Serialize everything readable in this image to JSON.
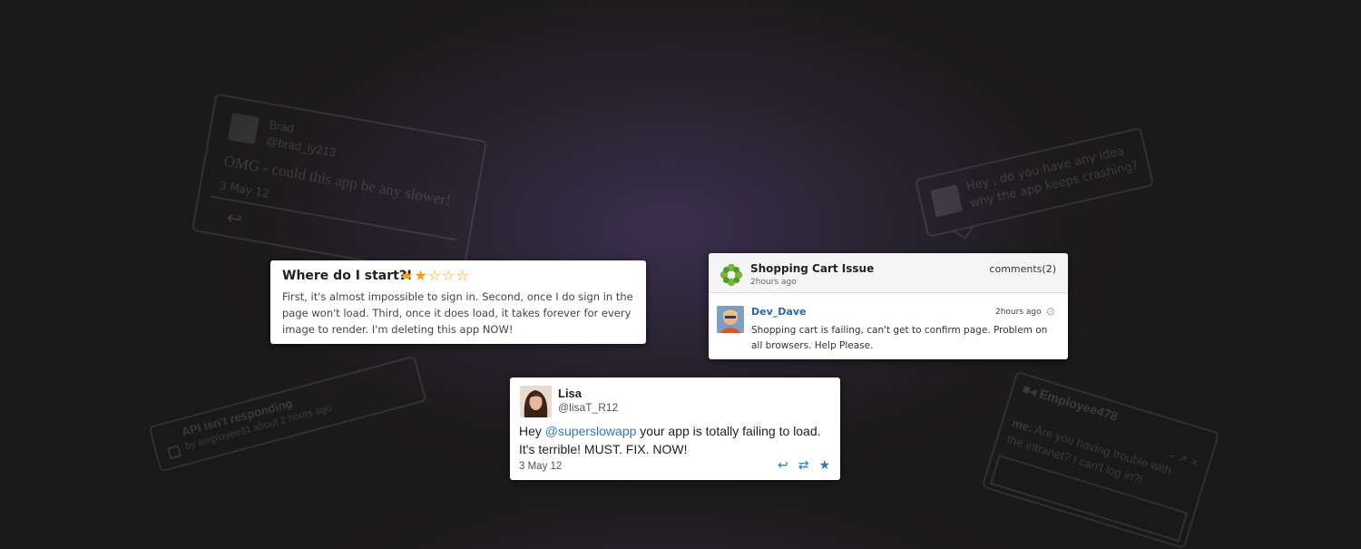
{
  "ghost_tweet": {
    "name": "Brad",
    "handle": "@brad_ly213",
    "text": "OMG - could this app be any slower!",
    "date": "3 May 12"
  },
  "ghost_bubble": {
    "line1": "Hey , do you have any idea",
    "line2": "why the app keeps crashing?"
  },
  "ghost_ticket": {
    "title": "API isn't responding",
    "subtitle": "by employee31 about 2 hours ago"
  },
  "ghost_chat": {
    "header": "Employee478",
    "controls": "– ↗ ×",
    "sender": "me:",
    "message": "Are you having trouble with the intranet? I can't log in?!"
  },
  "review": {
    "title": "Where do I start?!",
    "rating": 2,
    "max_rating": 5,
    "body": "First, it's almost impossible to sign in. Second, once I do sign in the page won't load. Third, once it does load, it takes forever for every image to render. I'm deleting this app NOW!",
    "star_color": "#f4a012"
  },
  "issue": {
    "title": "Shopping Cart Issue",
    "time_ago": "2hours ago",
    "comments": "comments(2)",
    "user": "Dev_Dave",
    "user_time_ago": "2hours ago",
    "message": "Shopping cart is failing, can't get to confirm page. Problem on all browsers. Help Please.",
    "user_color": "#2a63b5"
  },
  "tweet": {
    "name": "Lisa",
    "handle": "@lisaT_R12",
    "text_before": "Hey ",
    "mention": "@superslowapp",
    "text_after": " your app is totally failing to load. It's terrible! MUST. FIX. NOW!",
    "date": "3 May 12",
    "action_icons": [
      "reply-icon",
      "retweet-icon",
      "favorite-icon"
    ],
    "link_color": "#2d79c7"
  }
}
